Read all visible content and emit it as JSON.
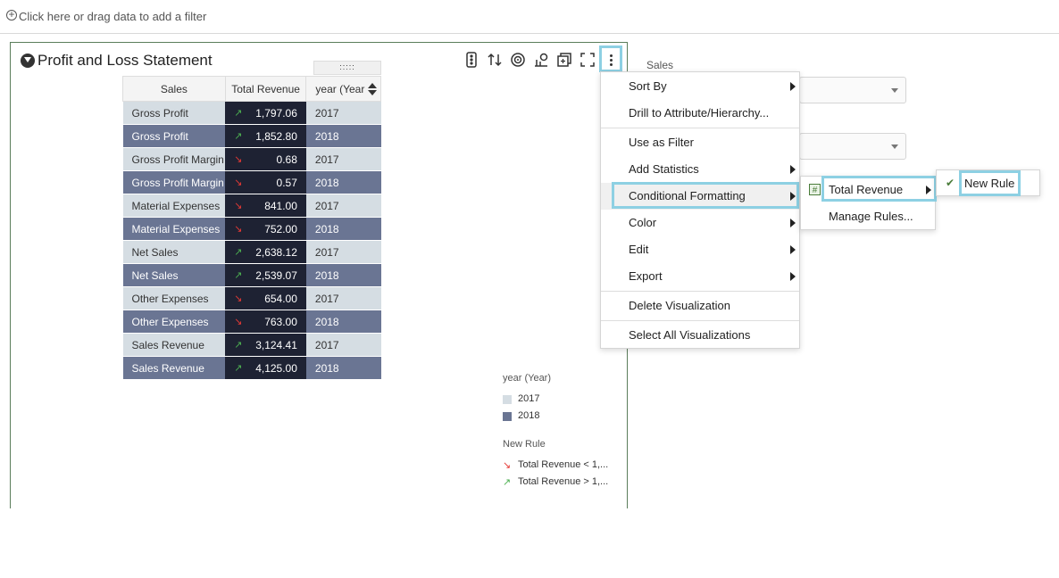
{
  "filter_bar": {
    "text": "Click here or drag data to add a filter"
  },
  "viz": {
    "title": "Profit and Loss Statement",
    "toolbar_icons": [
      "traffic-light-icon",
      "sort-icon",
      "target-icon",
      "chart-icon",
      "restore-icon",
      "fullscreen-icon",
      "more-options-icon"
    ]
  },
  "table": {
    "headers": [
      "Sales",
      "Total Revenue",
      "year (Year"
    ],
    "rows": [
      {
        "sales": "Gross Profit",
        "revenue": "1,797.06",
        "trend": "up",
        "year": "2017"
      },
      {
        "sales": "Gross Profit",
        "revenue": "1,852.80",
        "trend": "up",
        "year": "2018"
      },
      {
        "sales": "Gross Profit Margin",
        "revenue": "0.68",
        "trend": "down",
        "year": "2017"
      },
      {
        "sales": "Gross Profit Margin",
        "revenue": "0.57",
        "trend": "down",
        "year": "2018"
      },
      {
        "sales": "Material Expenses",
        "revenue": "841.00",
        "trend": "down",
        "year": "2017"
      },
      {
        "sales": "Material Expenses",
        "revenue": "752.00",
        "trend": "down",
        "year": "2018"
      },
      {
        "sales": "Net Sales",
        "revenue": "2,638.12",
        "trend": "up",
        "year": "2017"
      },
      {
        "sales": "Net Sales",
        "revenue": "2,539.07",
        "trend": "up",
        "year": "2018"
      },
      {
        "sales": "Other Expenses",
        "revenue": "654.00",
        "trend": "down",
        "year": "2017"
      },
      {
        "sales": "Other Expenses",
        "revenue": "763.00",
        "trend": "down",
        "year": "2018"
      },
      {
        "sales": "Sales Revenue",
        "revenue": "3,124.41",
        "trend": "up",
        "year": "2017"
      },
      {
        "sales": "Sales Revenue",
        "revenue": "4,125.00",
        "trend": "up",
        "year": "2018"
      }
    ]
  },
  "legend": {
    "year_title": "year (Year)",
    "years": [
      {
        "label": "2017",
        "color": "#d5dde3"
      },
      {
        "label": "2018",
        "color": "#6a7593"
      }
    ],
    "rule_title": "New Rule",
    "rules": [
      {
        "label": "Total Revenue < 1,...",
        "trend": "down"
      },
      {
        "label": "Total Revenue > 1,...",
        "trend": "up"
      }
    ]
  },
  "side_panel": {
    "label": "Sales"
  },
  "context_menu": {
    "items": [
      "Sort By",
      "Drill to Attribute/Hierarchy...",
      "Use as Filter",
      "Add Statistics",
      "Conditional Formatting",
      "Color",
      "Edit",
      "Export",
      "Delete Visualization",
      "Select All Visualizations"
    ]
  },
  "submenu": {
    "items": [
      "Total Revenue",
      "Manage Rules..."
    ]
  },
  "submenu2": {
    "items": [
      "New Rule"
    ]
  },
  "colors": {
    "highlight": "#8dd0e3",
    "up": "#4caf50",
    "down": "#e53935"
  }
}
